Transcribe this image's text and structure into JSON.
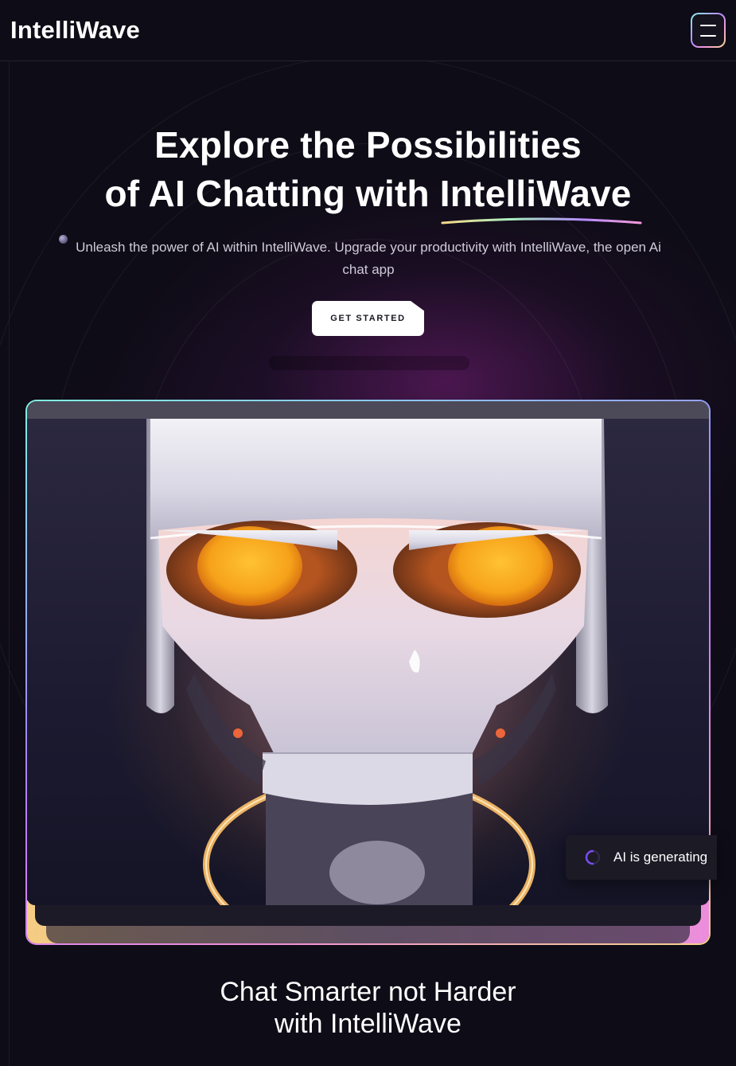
{
  "header": {
    "brand": "IntelliWave",
    "menu_icon": "hamburger-menu-icon"
  },
  "hero": {
    "title_line1": "Explore the Possibilities",
    "title_line2_prefix": "of AI Chatting with ",
    "title_line2_highlight": "IntelliWave",
    "subtitle": "Unleash the power of AI within IntelliWave. Upgrade your productivity with IntelliWave, the open Ai chat app",
    "cta_label": "GET STARTED"
  },
  "showcase": {
    "image": "robot-head-illustration",
    "status_text": "AI is generating",
    "status_icon": "loading-spinner-icon"
  },
  "section": {
    "title_line1": "Chat Smarter not Harder",
    "title_line2": "with IntelliWave"
  },
  "colors": {
    "background": "#0e0c16",
    "accent_teal": "#7ff0e0",
    "accent_purple": "#9d8cff",
    "accent_pink": "#f08fd8",
    "accent_gold": "#f3d28a",
    "robot_eye": "#f6a21a"
  }
}
